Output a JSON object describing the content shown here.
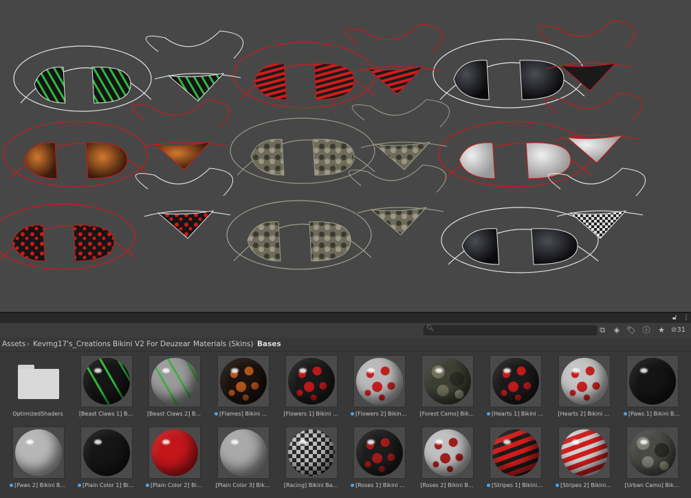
{
  "toolbar": {
    "search_placeholder": "",
    "hidden_count": "31",
    "icons": [
      "scene-search-icon",
      "filter-by-type-icon",
      "filter-by-label-icon",
      "info-icon",
      "favorite-star-icon",
      "hidden-eye-icon"
    ]
  },
  "breadcrumb": [
    "Assets",
    "Kevmg17's_Creations",
    "Bikini V2 For Deuzear",
    "Materials (Skins)",
    "Bases"
  ],
  "assets": [
    {
      "label": "OptimizedShaders",
      "kind": "folder",
      "dot": false
    },
    {
      "label": "[Beast Claws 1] B...",
      "kind": "material",
      "dot": false,
      "base": "#151515",
      "accent": "#2dbb3a",
      "pattern": "claws"
    },
    {
      "label": "[Beast Claws 2] B...",
      "kind": "material",
      "dot": false,
      "base": "#9a9a9a",
      "accent": "#3fae45",
      "pattern": "claws"
    },
    {
      "label": "[Flames] Bikini Ba...",
      "kind": "material",
      "dot": true,
      "base": "#1c130e",
      "accent": "#b3541a",
      "pattern": "spots"
    },
    {
      "label": "[Flowers 1] Bikini ...",
      "kind": "material",
      "dot": false,
      "base": "#1a1a1a",
      "accent": "#c01818",
      "pattern": "spots"
    },
    {
      "label": "[Flowers 2] Bikini...",
      "kind": "material",
      "dot": true,
      "base": "#b9b9b9",
      "accent": "#c22020",
      "pattern": "spots"
    },
    {
      "label": "[Forest Camo] Bik...",
      "kind": "material",
      "dot": false,
      "base": "#3c3f33",
      "accent": "#6d6d58",
      "pattern": "camo"
    },
    {
      "label": "[Hearts 1] Bikini ...",
      "kind": "material",
      "dot": true,
      "base": "#1b1b1b",
      "accent": "#c41a1a",
      "pattern": "spots"
    },
    {
      "label": "[Hearts 2] Bikini ...",
      "kind": "material",
      "dot": false,
      "base": "#c4c4c4",
      "accent": "#c42020",
      "pattern": "spots"
    },
    {
      "label": "[Paws 1] Bikini Ba...",
      "kind": "material",
      "dot": true,
      "base": "#141414",
      "accent": "#a81818",
      "pattern": "none"
    },
    {
      "label": "[Paws 2] Bikini Ba...",
      "kind": "material",
      "dot": true,
      "base": "#b7b7b7",
      "accent": "#bb2020",
      "pattern": "none"
    },
    {
      "label": "[Plain Color 1] Bik...",
      "kind": "material",
      "dot": true,
      "base": "#151515",
      "accent": "#151515",
      "pattern": "none"
    },
    {
      "label": "[Plain Color 2] Bik...",
      "kind": "material",
      "dot": true,
      "base": "#c4161a",
      "accent": "#c4161a",
      "pattern": "none"
    },
    {
      "label": "[Plain Color 3] Bik...",
      "kind": "material",
      "dot": false,
      "base": "#a9a9a9",
      "accent": "#a9a9a9",
      "pattern": "none"
    },
    {
      "label": "[Racing] Bikini Ba...",
      "kind": "material",
      "dot": false,
      "base": "#262626",
      "accent": "#bdbdbd",
      "pattern": "checker"
    },
    {
      "label": "[Roses 1] Bikini B...",
      "kind": "material",
      "dot": true,
      "base": "#1c1c1c",
      "accent": "#a31c1c",
      "pattern": "spots"
    },
    {
      "label": "[Roses 2] Bikini B...",
      "kind": "material",
      "dot": false,
      "base": "#c0c0c0",
      "accent": "#a11e1e",
      "pattern": "spots"
    },
    {
      "label": "[Stripes 1] Bikini ...",
      "kind": "material",
      "dot": true,
      "base": "#1a1a1a",
      "accent": "#d21c1c",
      "pattern": "stripes"
    },
    {
      "label": "[Stripes 2] Bikini ...",
      "kind": "material",
      "dot": true,
      "base": "#cfcfcf",
      "accent": "#d01c1c",
      "pattern": "stripes"
    },
    {
      "label": "[Urban Camo] Bik...",
      "kind": "material",
      "dot": false,
      "base": "#4a4a46",
      "accent": "#7d7d76",
      "pattern": "camo"
    }
  ]
}
